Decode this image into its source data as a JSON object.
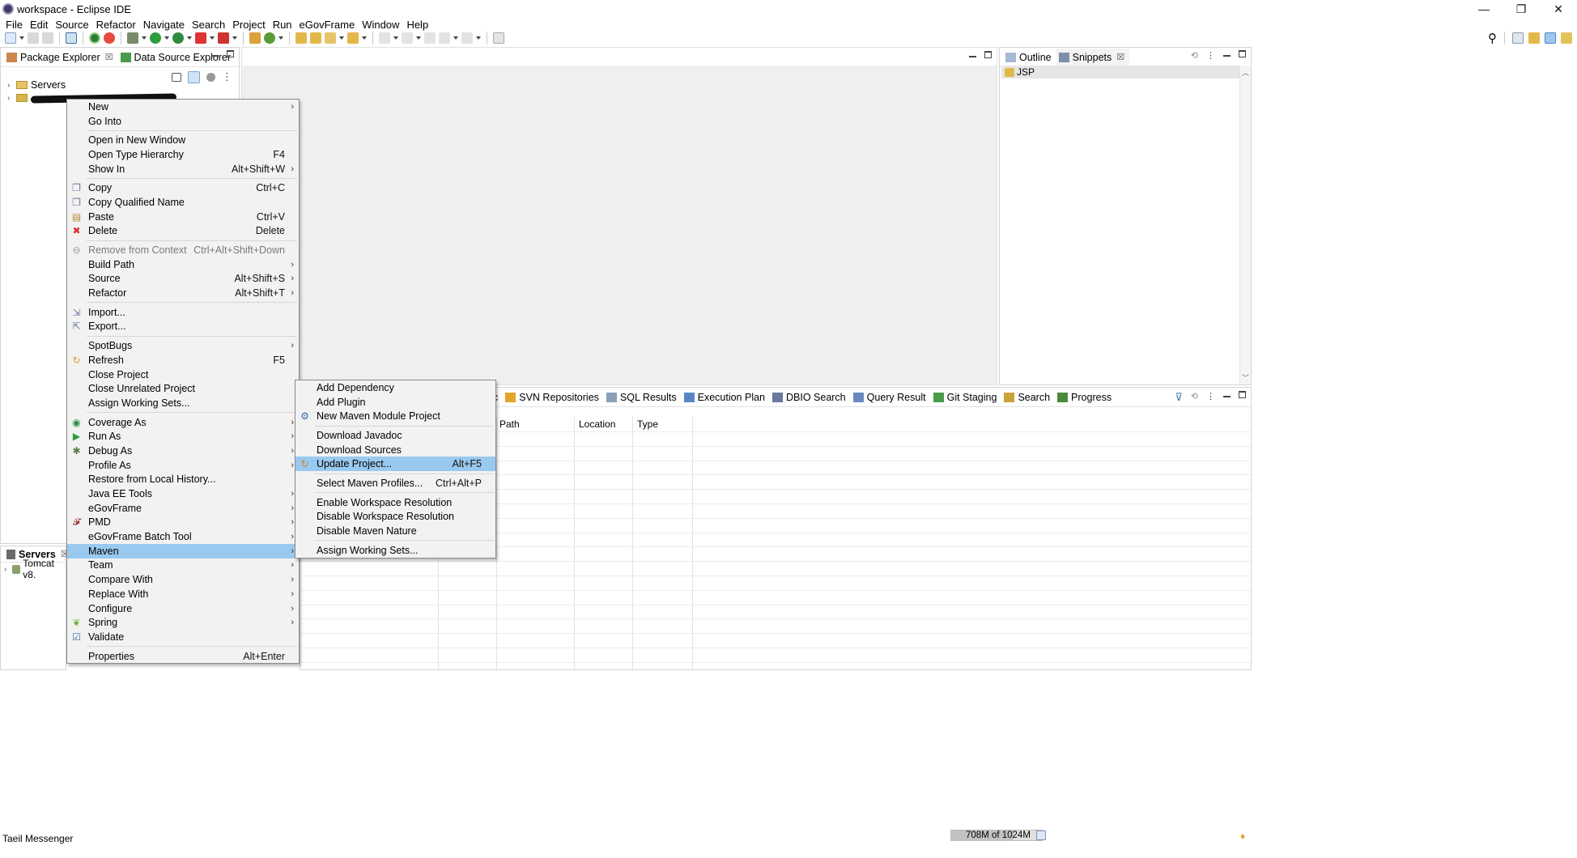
{
  "window": {
    "title": "workspace - Eclipse IDE",
    "controls": {
      "minimize": "—",
      "restore": "❐",
      "close": "✕"
    }
  },
  "menubar": [
    "File",
    "Edit",
    "Source",
    "Refactor",
    "Navigate",
    "Search",
    "Project",
    "Run",
    "eGovFrame",
    "Window",
    "Help"
  ],
  "left_pane": {
    "tabs": [
      {
        "label": "Package Explorer",
        "icon": "package-explorer-icon",
        "closable": true
      },
      {
        "label": "Data Source Explorer",
        "icon": "database-icon",
        "closable": false
      }
    ],
    "tree": [
      {
        "label": "Servers",
        "icon": "folder-icon"
      },
      {
        "label": "",
        "icon": "project-icon",
        "redacted": true
      }
    ]
  },
  "servers_pane": {
    "tab_label": "Servers",
    "items": [
      {
        "label": "Tomcat v8."
      }
    ]
  },
  "right_pane": {
    "tabs": [
      {
        "label": "Outline",
        "icon": "outline-icon"
      },
      {
        "label": "Snippets",
        "icon": "snippets-icon",
        "closable": true
      }
    ],
    "items": [
      {
        "label": "JSP"
      }
    ]
  },
  "bottom_pane": {
    "tabs_visible_partial": "c",
    "tabs": [
      {
        "label": "SVN Repositories",
        "icon": "svn-icon"
      },
      {
        "label": "SQL Results",
        "icon": "sql-results-icon"
      },
      {
        "label": "Execution Plan",
        "icon": "execution-plan-icon"
      },
      {
        "label": "DBIO Search",
        "icon": "search-icon"
      },
      {
        "label": "Query Result",
        "icon": "query-result-icon"
      },
      {
        "label": "Git Staging",
        "icon": "git-icon"
      },
      {
        "label": "Search",
        "icon": "search-icon"
      },
      {
        "label": "Progress",
        "icon": "progress-icon"
      }
    ],
    "columns": [
      "Path",
      "Location",
      "Type"
    ]
  },
  "context_menu": {
    "items": [
      {
        "label": "New",
        "submenu": true
      },
      {
        "label": "Go Into"
      },
      {
        "sep": true
      },
      {
        "label": "Open in New Window"
      },
      {
        "label": "Open Type Hierarchy",
        "shortcut": "F4"
      },
      {
        "label": "Show In",
        "shortcut": "Alt+Shift+W",
        "submenu": true
      },
      {
        "sep": true
      },
      {
        "label": "Copy",
        "shortcut": "Ctrl+C",
        "icon": "copy-icon"
      },
      {
        "label": "Copy Qualified Name",
        "icon": "copy-icon"
      },
      {
        "label": "Paste",
        "shortcut": "Ctrl+V",
        "icon": "paste-icon"
      },
      {
        "label": "Delete",
        "shortcut": "Delete",
        "icon": "delete-icon"
      },
      {
        "sep": true
      },
      {
        "label": "Remove from Context",
        "shortcut": "Ctrl+Alt+Shift+Down",
        "disabled": true,
        "icon": "remove-context-icon"
      },
      {
        "label": "Build Path",
        "submenu": true
      },
      {
        "label": "Source",
        "shortcut": "Alt+Shift+S",
        "submenu": true
      },
      {
        "label": "Refactor",
        "shortcut": "Alt+Shift+T",
        "submenu": true
      },
      {
        "sep": true
      },
      {
        "label": "Import...",
        "icon": "import-icon"
      },
      {
        "label": "Export...",
        "icon": "export-icon"
      },
      {
        "sep": true
      },
      {
        "label": "SpotBugs",
        "submenu": true
      },
      {
        "label": "Refresh",
        "shortcut": "F5",
        "icon": "refresh-icon"
      },
      {
        "label": "Close Project"
      },
      {
        "label": "Close Unrelated Project"
      },
      {
        "label": "Assign Working Sets..."
      },
      {
        "sep": true
      },
      {
        "label": "Coverage As",
        "submenu": true,
        "icon": "coverage-icon"
      },
      {
        "label": "Run As",
        "submenu": true,
        "icon": "run-icon"
      },
      {
        "label": "Debug As",
        "submenu": true,
        "icon": "debug-icon"
      },
      {
        "label": "Profile As",
        "submenu": true
      },
      {
        "label": "Restore from Local History..."
      },
      {
        "label": "Java EE Tools",
        "submenu": true
      },
      {
        "label": "eGovFrame",
        "submenu": true
      },
      {
        "label": "PMD",
        "submenu": true,
        "icon": "pmd-icon"
      },
      {
        "label": "eGovFrame Batch Tool",
        "submenu": true
      },
      {
        "label": "Maven",
        "submenu": true,
        "highlighted": true
      },
      {
        "label": "Team",
        "submenu": true
      },
      {
        "label": "Compare With",
        "submenu": true
      },
      {
        "label": "Replace With",
        "submenu": true
      },
      {
        "label": "Configure",
        "submenu": true
      },
      {
        "label": "Spring",
        "submenu": true,
        "icon": "spring-icon"
      },
      {
        "label": "Validate",
        "icon": "validate-icon"
      },
      {
        "sep": true
      },
      {
        "label": "Properties",
        "shortcut": "Alt+Enter"
      }
    ]
  },
  "maven_submenu": {
    "items": [
      {
        "label": "Add Dependency"
      },
      {
        "label": "Add Plugin"
      },
      {
        "label": "New Maven Module Project",
        "icon": "maven-module-icon"
      },
      {
        "sep": true
      },
      {
        "label": "Download Javadoc"
      },
      {
        "label": "Download Sources"
      },
      {
        "label": "Update Project...",
        "shortcut": "Alt+F5",
        "icon": "update-icon",
        "highlighted": true
      },
      {
        "sep": true
      },
      {
        "label": "Select Maven Profiles...",
        "shortcut": "Ctrl+Alt+P"
      },
      {
        "sep": true
      },
      {
        "label": "Enable Workspace Resolution"
      },
      {
        "label": "Disable Workspace Resolution"
      },
      {
        "label": "Disable Maven Nature"
      },
      {
        "sep": true
      },
      {
        "label": "Assign Working Sets..."
      }
    ]
  },
  "status": {
    "left": "Taeil Messenger",
    "heap": "708M of 1024M"
  }
}
